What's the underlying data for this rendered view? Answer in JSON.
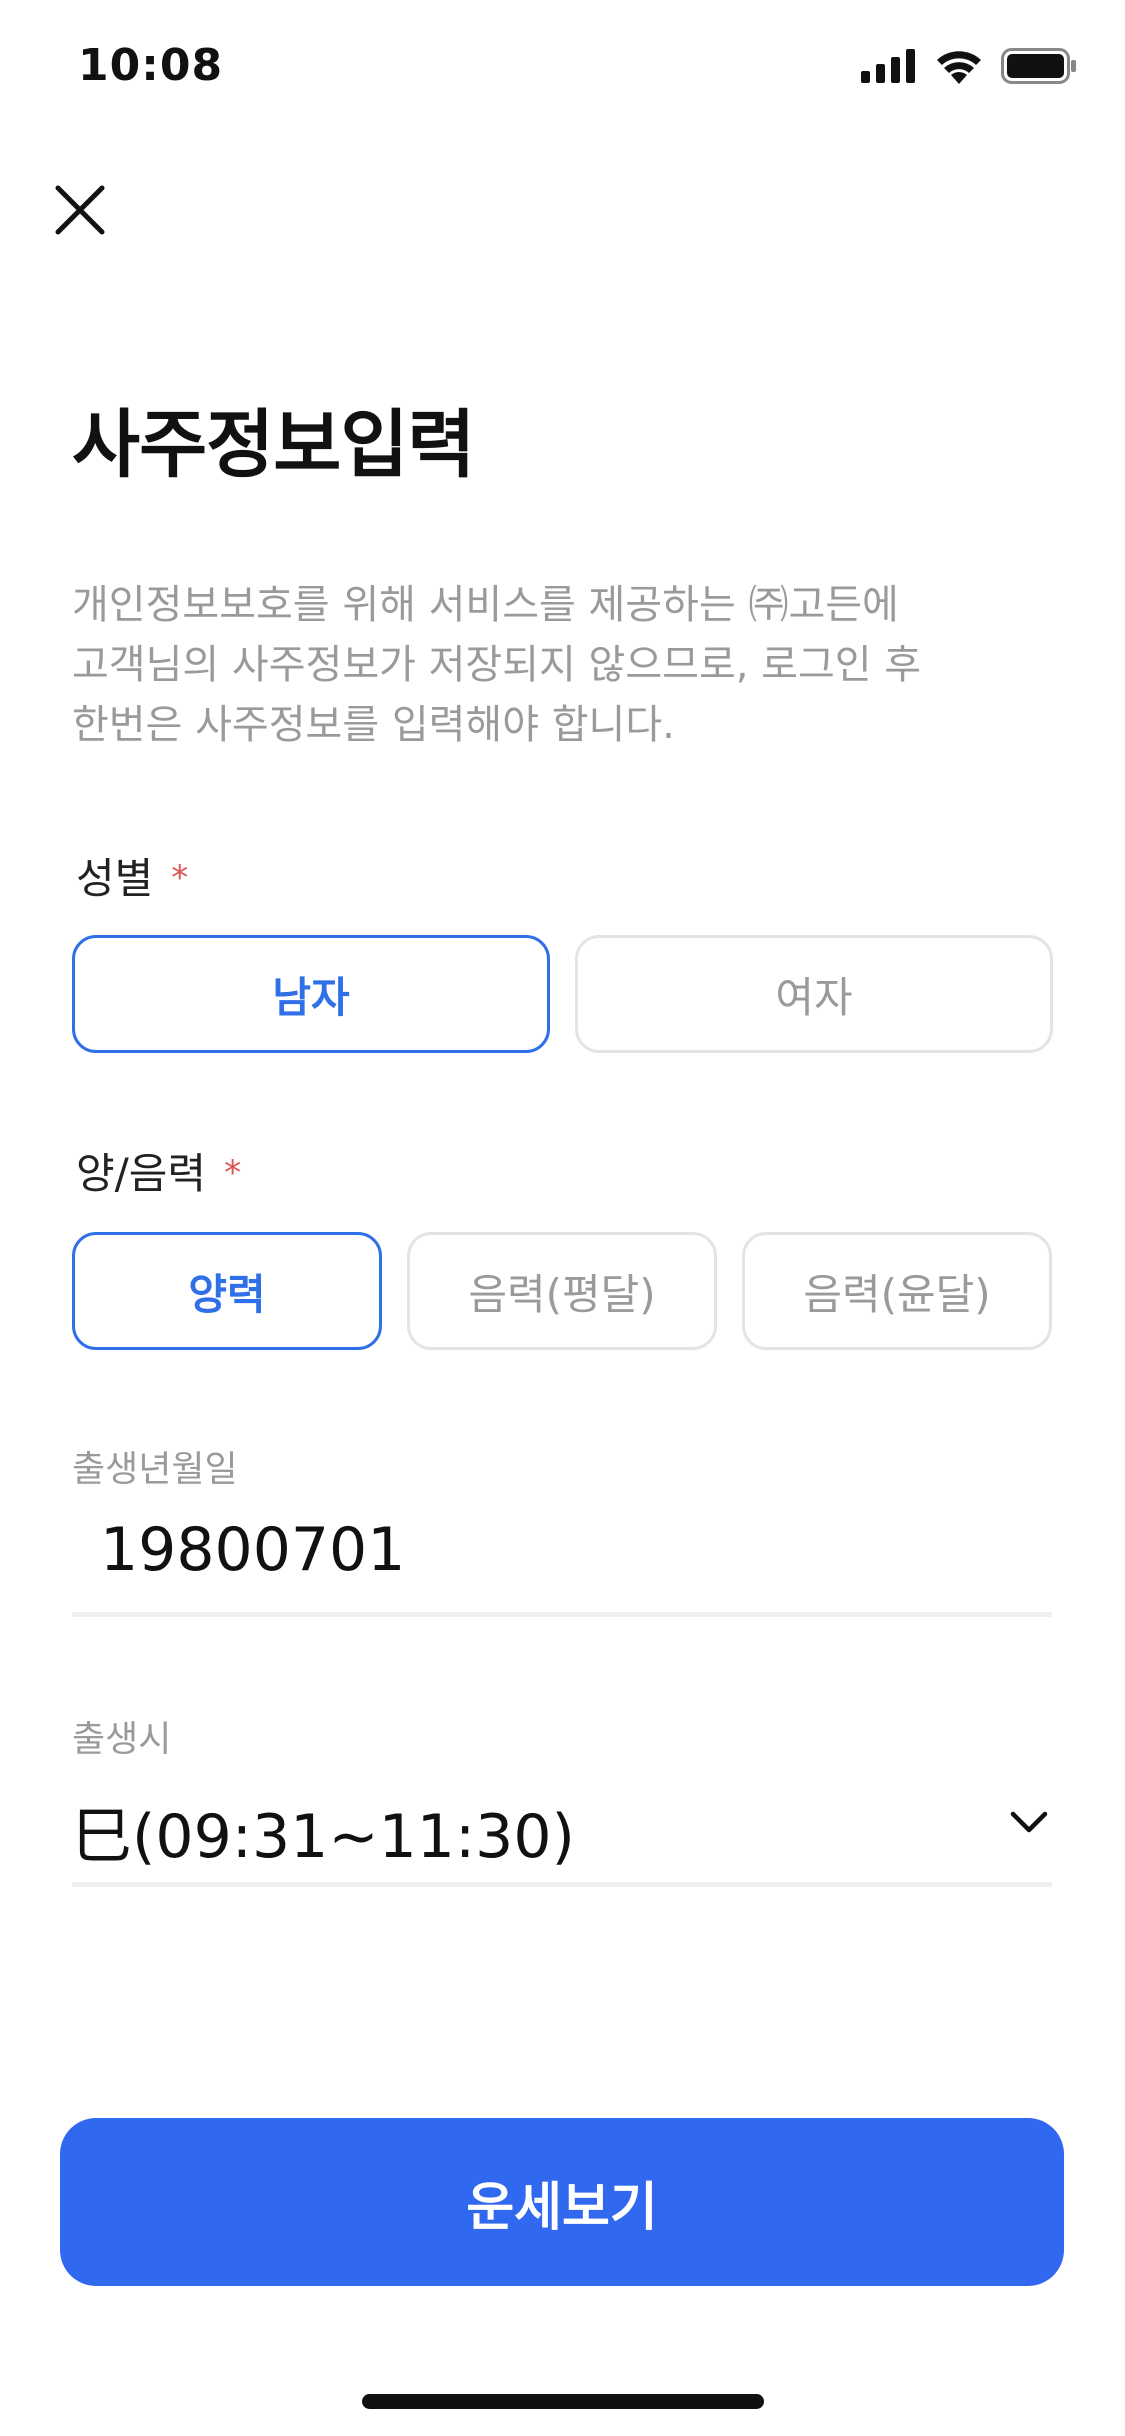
{
  "status_bar": {
    "time": "10:08",
    "icons": [
      "signal-icon",
      "wifi-icon",
      "battery-icon"
    ]
  },
  "header": {
    "close_icon": "close-icon",
    "title": "사주정보입력"
  },
  "description": "개인정보보호를 위해 서비스를 제공하는 ㈜고든에\n고객님의 사주정보가 저장되지 않으므로, 로그인 후\n한번은 사주정보를 입력해야 합니다.",
  "gender": {
    "label": "성별",
    "required_mark": "*",
    "options": [
      {
        "label": "남자",
        "selected": true
      },
      {
        "label": "여자",
        "selected": false
      }
    ]
  },
  "calendar": {
    "label": "양/음력",
    "required_mark": "*",
    "options": [
      {
        "label": "양력",
        "selected": true
      },
      {
        "label": "음력(평달)",
        "selected": false
      },
      {
        "label": "음력(윤달)",
        "selected": false
      }
    ]
  },
  "birth_date": {
    "label": "출생년월일",
    "value": "19800701"
  },
  "birth_time": {
    "label": "출생시",
    "value": "巳(09:31~11:30)",
    "dropdown_icon": "chevron-down-icon"
  },
  "submit": {
    "label": "운세보기"
  },
  "colors": {
    "accent": "#2f6fe8",
    "button": "#3068f0",
    "required": "#e05252",
    "muted_text": "#9a9a9a",
    "border": "#e4e4e4"
  }
}
